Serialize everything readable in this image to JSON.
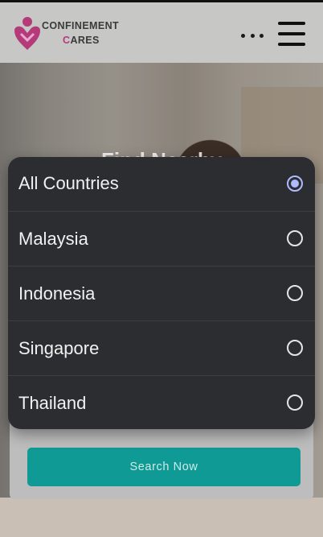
{
  "header": {
    "brand_line1": "CONFINEMENT",
    "brand_line2_accent": "C",
    "brand_line2_rest": "ARES",
    "more_icon": "more-horizontal-icon",
    "menu_icon": "hamburger-menu-icon"
  },
  "hero": {
    "title_partial": "Find Nearby"
  },
  "dropdown": {
    "options": [
      {
        "label": "All Countries",
        "selected": true
      },
      {
        "label": "Malaysia",
        "selected": false
      },
      {
        "label": "Indonesia",
        "selected": false
      },
      {
        "label": "Singapore",
        "selected": false
      },
      {
        "label": "Thailand",
        "selected": false
      }
    ]
  },
  "search": {
    "button_label": "Search Now"
  },
  "colors": {
    "brand_pink": "#b43a7a",
    "teal": "#0f9a95",
    "dropdown_bg": "#2c2d30",
    "radio_selected": "#aeb9ff"
  }
}
